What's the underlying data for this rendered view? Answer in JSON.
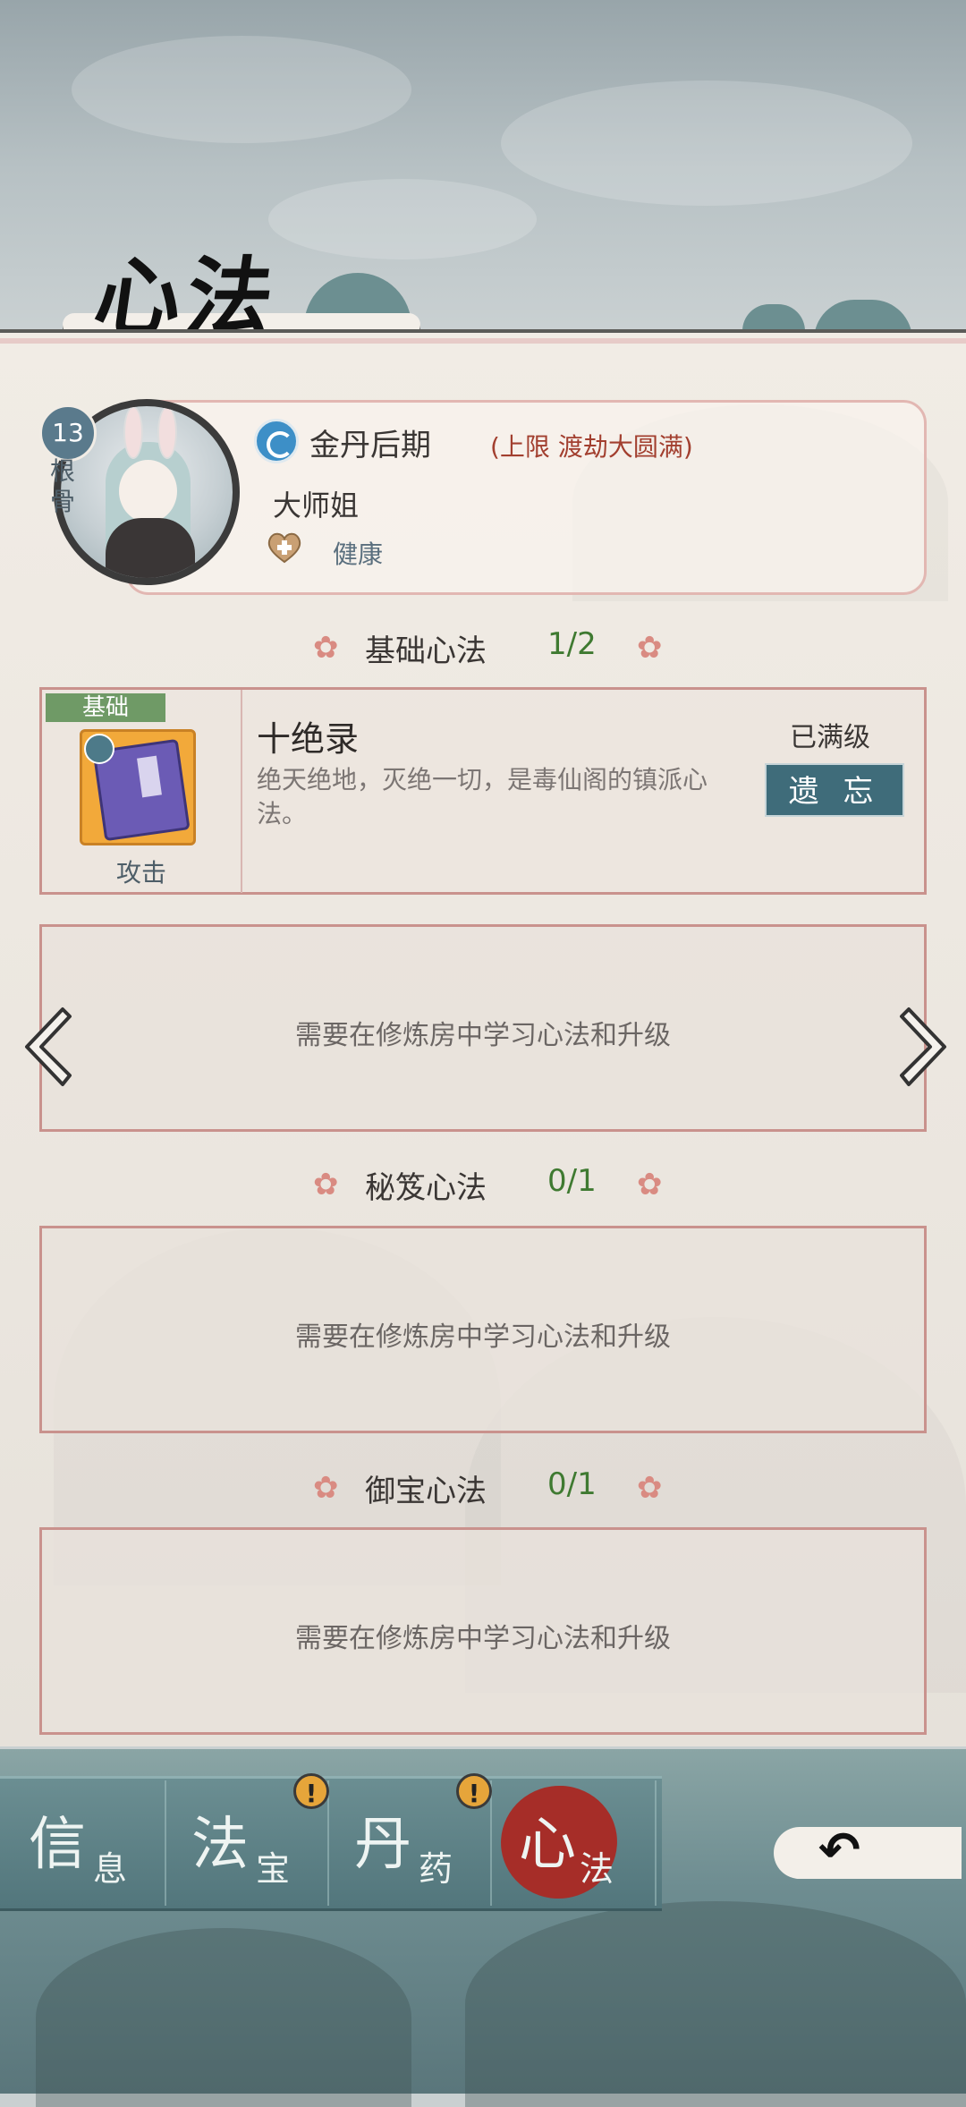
{
  "page": {
    "title": "心法"
  },
  "character": {
    "level": "13",
    "level_label": "根骨",
    "realm": "金丹后期",
    "realm_limit": "(上限 渡劫大圆满)",
    "name": "大师姐",
    "status": "健康",
    "portrait_icon": "character-portrait",
    "realm_icon": "water-swirl-icon",
    "status_icon": "heart-plus-icon"
  },
  "sections": [
    {
      "name": "基础心法",
      "count": "1/2",
      "slots": [
        {
          "filled": true,
          "tag": "基础",
          "title": "十绝录",
          "desc": "绝天绝地，灭绝一切，是毒仙阁的镇派心法。",
          "type": "攻击",
          "status": "已满级",
          "button": "遗 忘"
        },
        {
          "filled": false,
          "hint": "需要在修炼房中学习心法和升级"
        }
      ]
    },
    {
      "name": "秘笈心法",
      "count": "0/1",
      "slots": [
        {
          "filled": false,
          "hint": "需要在修炼房中学习心法和升级"
        }
      ]
    },
    {
      "name": "御宝心法",
      "count": "0/1",
      "slots": [
        {
          "filled": false,
          "hint": "需要在修炼房中学习心法和升级"
        }
      ]
    }
  ],
  "nav": {
    "tabs": [
      {
        "big": "信",
        "small": "息",
        "alert": false,
        "active": false
      },
      {
        "big": "法",
        "small": "宝",
        "alert": true,
        "active": false
      },
      {
        "big": "丹",
        "small": "药",
        "alert": true,
        "active": false
      },
      {
        "big": "心",
        "small": "法",
        "alert": false,
        "active": true
      }
    ],
    "alert_symbol": "!",
    "back_icon": "back-arrow-icon"
  },
  "colors": {
    "accent_red": "#a62d28",
    "count_green": "#3f7a31",
    "button_teal": "#3f6c7a",
    "limit_red": "#a23f2f"
  }
}
